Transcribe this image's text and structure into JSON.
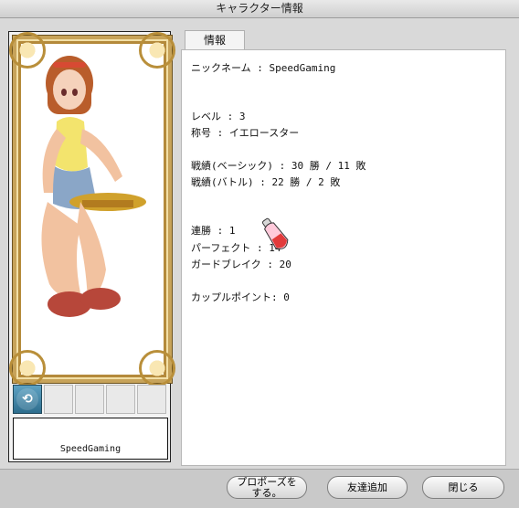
{
  "window": {
    "title": "キャラクター情報"
  },
  "tabs": [
    {
      "label": "情報"
    }
  ],
  "profile": {
    "name": "SpeedGaming"
  },
  "info": {
    "lines": [
      "ニックネーム : SpeedGaming",
      "レベル : 3",
      "称号 : イエロースター",
      "戦績(ベーシック) : 30 勝 / 11 敗",
      "戦績(バトル) : 22 勝 / 2 敗",
      "連勝 : 1",
      "パーフェクト : 14",
      "ガードブレイク : 20",
      "カップルポイント:  0"
    ]
  },
  "buttons": {
    "propose": "プロポーズをする。",
    "add_friend": "友達追加",
    "close": "閉じる"
  },
  "colors": {
    "frame_gold": "#c7a35a",
    "panel_gray": "#d9d9d9",
    "accent_blue": "#4f90b3"
  },
  "icons": {
    "slot_1": "character-emblem-icon",
    "cursor": "potion-cursor-icon"
  }
}
